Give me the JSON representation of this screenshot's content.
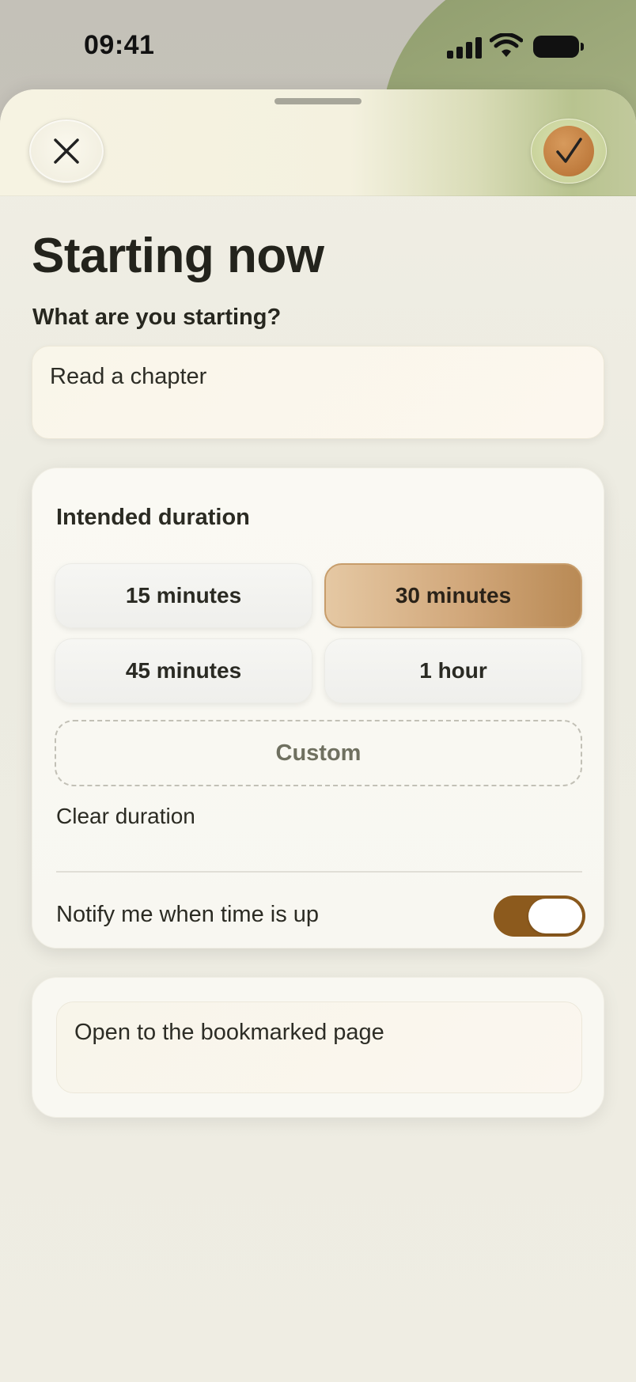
{
  "status_bar": {
    "time": "09:41"
  },
  "header": {
    "close_icon": "close-icon",
    "confirm_icon": "checkmark-icon"
  },
  "page": {
    "title": "Starting now",
    "task_label": "What are you starting?",
    "task_value": "Read a chapter"
  },
  "duration": {
    "title": "Intended duration",
    "options": [
      {
        "label": "15 minutes",
        "selected": false
      },
      {
        "label": "30 minutes",
        "selected": true
      },
      {
        "label": "45 minutes",
        "selected": false
      },
      {
        "label": "1 hour",
        "selected": false
      }
    ],
    "custom_label": "Custom",
    "clear_label": "Clear duration",
    "notify_label": "Notify me when time is up",
    "notify_enabled": true
  },
  "note": {
    "value": "Open to the bookmarked page"
  },
  "colors": {
    "accent": "#8c5a1d",
    "selected_chip": "#d1a77a",
    "confirm": "#bf7b3d"
  }
}
